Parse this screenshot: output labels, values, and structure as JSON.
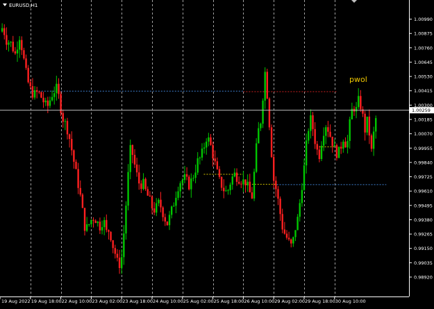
{
  "symbol": {
    "label": "EURUSD,H1"
  },
  "annotation": {
    "text": "pwol"
  },
  "current_price_label": "1.00259",
  "colors": {
    "up": "#00c800",
    "down": "#ff2020",
    "grid": "#c8c8c8",
    "background": "#000000",
    "hline_blue": "#3f7fd0",
    "hline_red": "#d02020",
    "hline_yellow": "#d4c400",
    "annotation": "#f0c800"
  },
  "chart_data": {
    "type": "candlestick",
    "title": "EURUSD,H1",
    "ylim": [
      0.9892,
      1.0106
    ],
    "y_ticks": [
      "1.00990",
      "1.00875",
      "1.00760",
      "1.00645",
      "1.00530",
      "1.00415",
      "1.00300",
      "1.00185",
      "1.00070",
      "0.99955",
      "0.99840",
      "0.99725",
      "0.99610",
      "0.99495",
      "0.99380",
      "0.99265",
      "0.99150",
      "0.99035",
      "0.98920"
    ],
    "x_ticks": [
      "19 Aug 2022",
      "19 Aug 18:00",
      "22 Aug 10:00",
      "23 Aug 02:00",
      "23 Aug 18:00",
      "24 Aug 10:00",
      "25 Aug 02:00",
      "25 Aug 18:00",
      "26 Aug 10:00",
      "29 Aug 02:00",
      "29 Aug 18:00",
      "30 Aug 10:00"
    ],
    "current_price": 1.00259,
    "horizontal_levels": [
      {
        "price": 1.00412,
        "style": "dotted",
        "color": "blue",
        "from_tick": 1,
        "to_tick": 8
      },
      {
        "price": 1.00408,
        "style": "dotted",
        "color": "red",
        "from_tick": 8,
        "to_tick": 11.1
      },
      {
        "price": 0.99965,
        "style": "dotted",
        "color": "yellow",
        "from_tick": 10.4,
        "to_tick": 11.1
      },
      {
        "price": 0.99745,
        "style": "dotted",
        "color": "yellow",
        "from_tick": 6.7,
        "to_tick": 8
      },
      {
        "price": 0.99665,
        "style": "dotted",
        "color": "yellow",
        "from_tick": 8.1,
        "to_tick": 9.1
      },
      {
        "price": 0.99662,
        "style": "dotted",
        "color": "blue",
        "from_tick": 9.1,
        "to_tick": 12.7
      }
    ],
    "close_path": [
      [
        0,
        1.0089
      ],
      [
        0.1,
        1.0093
      ],
      [
        0.2,
        1.0082
      ],
      [
        0.35,
        1.008
      ],
      [
        0.5,
        1.0071
      ],
      [
        0.65,
        1.0086
      ],
      [
        0.8,
        1.0064
      ],
      [
        0.9,
        1.005
      ],
      [
        1.0,
        1.0043
      ],
      [
        1.1,
        1.0038
      ],
      [
        1.2,
        1.004
      ],
      [
        1.3,
        1.0039
      ],
      [
        1.45,
        1.0032
      ],
      [
        1.55,
        1.0028
      ],
      [
        1.7,
        1.0038
      ],
      [
        1.85,
        1.0044
      ],
      [
        1.95,
        1.0035
      ],
      [
        2.05,
        1.002
      ],
      [
        2.15,
        1.0015
      ],
      [
        2.25,
        1.0008
      ],
      [
        2.35,
        0.9995
      ],
      [
        2.45,
        0.9982
      ],
      [
        2.55,
        0.9969
      ],
      [
        2.65,
        0.9956
      ],
      [
        2.8,
        0.993
      ],
      [
        2.9,
        0.9933
      ],
      [
        3.0,
        0.9938
      ],
      [
        3.1,
        0.994
      ],
      [
        3.2,
        0.9936
      ],
      [
        3.3,
        0.9932
      ],
      [
        3.4,
        0.9939
      ],
      [
        3.5,
        0.9928
      ],
      [
        3.6,
        0.993
      ],
      [
        3.7,
        0.9918
      ],
      [
        3.8,
        0.991
      ],
      [
        3.9,
        0.99
      ],
      [
        4.0,
        0.9908
      ],
      [
        4.1,
        0.9935
      ],
      [
        4.2,
        0.997
      ],
      [
        4.3,
        0.9998
      ],
      [
        4.4,
        0.9985
      ],
      [
        4.5,
        0.9974
      ],
      [
        4.6,
        0.9965
      ],
      [
        4.7,
        0.9968
      ],
      [
        4.8,
        0.996
      ],
      [
        4.9,
        0.9955
      ],
      [
        5.0,
        0.9948
      ],
      [
        5.1,
        0.9945
      ],
      [
        5.2,
        0.9952
      ],
      [
        5.3,
        0.9948
      ],
      [
        5.4,
        0.994
      ],
      [
        5.5,
        0.9935
      ],
      [
        5.6,
        0.9942
      ],
      [
        5.7,
        0.995
      ],
      [
        5.8,
        0.996
      ],
      [
        5.9,
        0.9968
      ],
      [
        6.0,
        0.997
      ],
      [
        6.1,
        0.9972
      ],
      [
        6.2,
        0.9965
      ],
      [
        6.3,
        0.997
      ],
      [
        6.4,
        0.9976
      ],
      [
        6.5,
        0.9985
      ],
      [
        6.6,
        0.9988
      ],
      [
        6.7,
        0.9996
      ],
      [
        6.8,
        1.0005
      ],
      [
        6.9,
        1.0
      ],
      [
        7.0,
        0.999
      ],
      [
        7.1,
        0.998
      ],
      [
        7.2,
        0.997
      ],
      [
        7.3,
        0.9965
      ],
      [
        7.4,
        0.996
      ],
      [
        7.5,
        0.9962
      ],
      [
        7.6,
        0.997
      ],
      [
        7.7,
        0.9975
      ],
      [
        7.8,
        0.9972
      ],
      [
        7.9,
        0.997
      ],
      [
        8.0,
        0.9969
      ],
      [
        8.1,
        0.9968
      ],
      [
        8.2,
        0.996
      ],
      [
        8.3,
        0.9956
      ],
      [
        8.4,
        0.999
      ],
      [
        8.5,
        1.001
      ],
      [
        8.6,
        1.002
      ],
      [
        8.7,
        1.006
      ],
      [
        8.8,
        1.0035
      ],
      [
        8.9,
        1.0
      ],
      [
        9.0,
        0.997
      ],
      [
        9.1,
        0.996
      ],
      [
        9.2,
        0.9945
      ],
      [
        9.3,
        0.993
      ],
      [
        9.4,
        0.9925
      ],
      [
        9.5,
        0.992
      ],
      [
        9.6,
        0.9916
      ],
      [
        9.7,
        0.993
      ],
      [
        9.8,
        0.994
      ],
      [
        9.9,
        0.996
      ],
      [
        10.0,
        0.998
      ],
      [
        10.1,
        1.0005
      ],
      [
        10.2,
        1.002
      ],
      [
        10.3,
        1.001
      ],
      [
        10.4,
        0.9995
      ],
      [
        10.5,
        0.999
      ],
      [
        10.6,
        1.0005
      ],
      [
        10.7,
        1.0015
      ],
      [
        10.8,
        1.001
      ],
      [
        10.9,
        1.0002
      ],
      [
        11.0,
        0.9995
      ],
      [
        11.1,
        0.999
      ],
      [
        11.2,
        0.9996
      ],
      [
        11.3,
        1.0005
      ],
      [
        11.4,
        0.9995
      ],
      [
        11.5,
        1.0015
      ],
      [
        11.6,
        1.003
      ],
      [
        11.7,
        1.0025
      ],
      [
        11.8,
        1.0035
      ],
      [
        11.9,
        1.0025
      ],
      [
        12.0,
        1.001
      ],
      [
        12.1,
        1.002
      ],
      [
        12.2,
        0.999
      ],
      [
        12.3,
        1.001
      ],
      [
        12.4,
        1.00259
      ]
    ]
  }
}
